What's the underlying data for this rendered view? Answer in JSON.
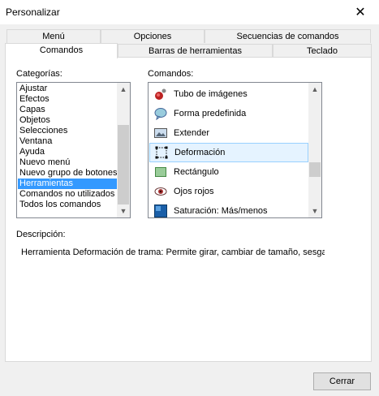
{
  "window": {
    "title": "Personalizar",
    "close_glyph": "✕"
  },
  "tabs": {
    "row1": [
      "Menú",
      "Opciones",
      "Secuencias de comandos"
    ],
    "row2": [
      "Comandos",
      "Barras de herramientas",
      "Teclado"
    ],
    "active": "Comandos"
  },
  "categories": {
    "label": "Categorías:",
    "items": [
      "Ajustar",
      "Efectos",
      "Capas",
      "Objetos",
      "Selecciones",
      "Ventana",
      "Ayuda",
      "Nuevo menú",
      "Nuevo grupo de botones",
      "Herramientas",
      "Comandos no utilizados",
      "Todos los comandos"
    ],
    "selected": "Herramientas"
  },
  "commands": {
    "label": "Comandos:",
    "items": [
      {
        "label": "Tubo de imágenes",
        "icon": "picture-tube-icon"
      },
      {
        "label": "Forma predefinida",
        "icon": "preset-shape-icon"
      },
      {
        "label": "Extender",
        "icon": "extend-icon"
      },
      {
        "label": "Deformación",
        "icon": "deform-icon"
      },
      {
        "label": "Rectángulo",
        "icon": "rectangle-icon"
      },
      {
        "label": "Ojos rojos",
        "icon": "red-eye-icon"
      },
      {
        "label": "Saturación: Más/menos",
        "icon": "saturation-icon"
      }
    ],
    "selected": "Deformación"
  },
  "description": {
    "label": "Descripción:",
    "text": "Herramienta Deformación de trama: Permite girar, cambiar de tamaño, sesgar y"
  },
  "footer": {
    "close_label": "Cerrar"
  },
  "colors": {
    "selection": "#3399ff",
    "hover_selection": "#e5f3ff"
  }
}
